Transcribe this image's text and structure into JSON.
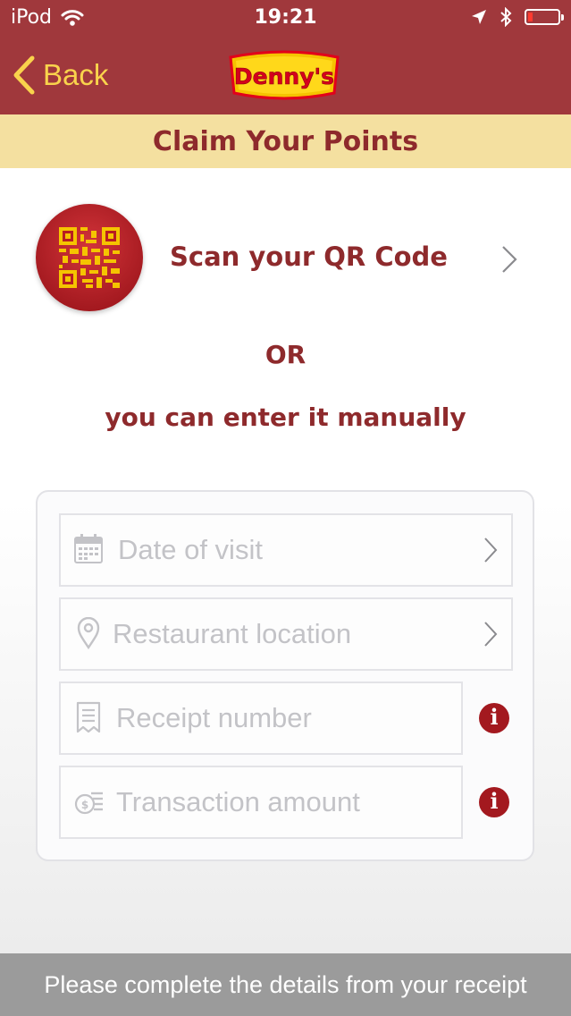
{
  "status_bar": {
    "carrier": "iPod",
    "time": "19:21"
  },
  "nav": {
    "back_label": "Back",
    "logo_text": "Denny's"
  },
  "subheader": {
    "title": "Claim Your Points"
  },
  "scan": {
    "label": "Scan your QR Code",
    "icon": "qr-code-icon"
  },
  "divider": {
    "or_text": "OR",
    "manual_text": "you can enter it manually"
  },
  "form": {
    "fields": [
      {
        "placeholder": "Date of visit",
        "icon": "calendar-icon"
      },
      {
        "placeholder": "Restaurant location",
        "icon": "location-pin-icon"
      },
      {
        "placeholder": "Receipt number",
        "icon": "receipt-icon"
      },
      {
        "placeholder": "Transaction amount",
        "icon": "coins-icon"
      }
    ],
    "info_glyph": "i"
  },
  "footer": {
    "message": "Please complete the details from your receipt"
  },
  "colors": {
    "brand_red": "#a0383c",
    "title_red": "#8e2a2c",
    "accent_yellow": "#f9d34c",
    "subheader_bg": "#f4e0a0",
    "footer_bg": "#9b9b9b"
  }
}
